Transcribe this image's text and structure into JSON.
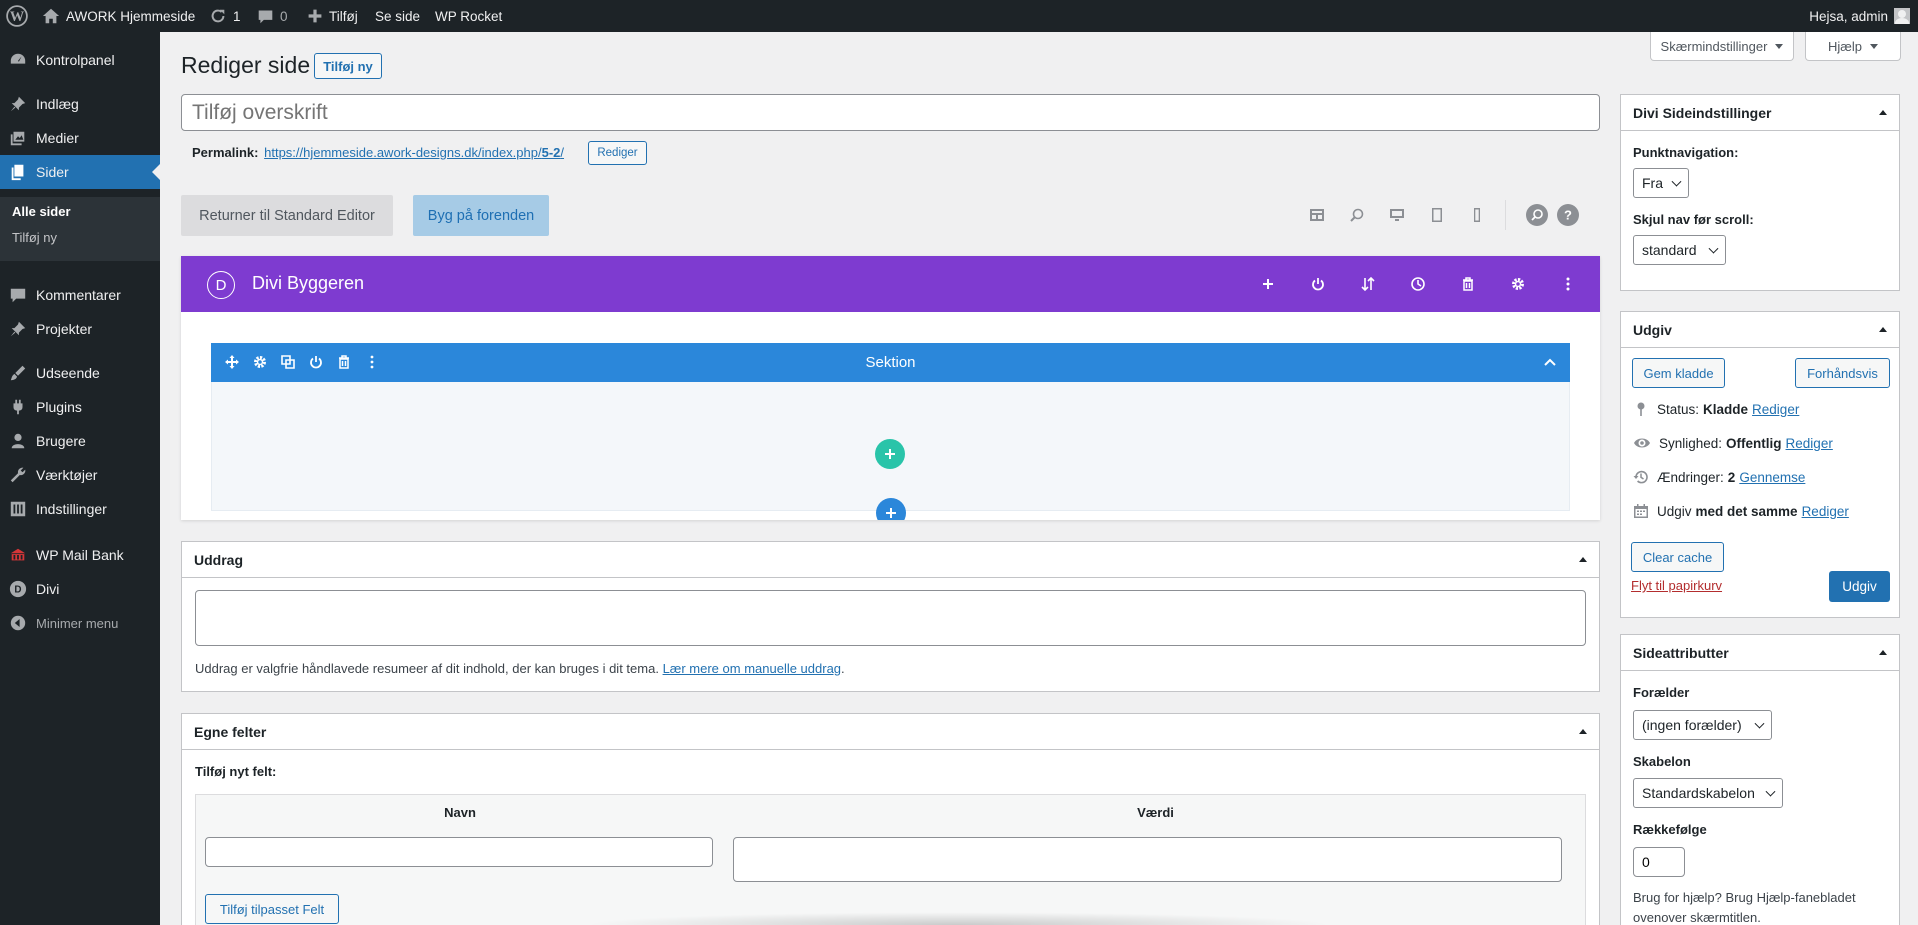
{
  "admin_bar": {
    "site_name": "AWORK Hjemmeside",
    "updates_count": "1",
    "comments_count": "0",
    "new_label": "Tilføj",
    "view_page": "Se side",
    "wp_rocket": "WP Rocket",
    "greeting": "Hejsa, admin"
  },
  "sidebar": {
    "dashboard": "Kontrolpanel",
    "posts": "Indlæg",
    "media": "Medier",
    "pages": "Sider",
    "pages_sub": [
      "Alle sider",
      "Tilføj ny"
    ],
    "comments": "Kommentarer",
    "projects": "Projekter",
    "appearance": "Udseende",
    "plugins": "Plugins",
    "users": "Brugere",
    "tools": "Værktøjer",
    "settings": "Indstillinger",
    "wp_mail_bank": "WP Mail Bank",
    "divi": "Divi",
    "collapse": "Minimer menu"
  },
  "screen_options": "Skærmindstillinger",
  "help": "Hjælp",
  "page_title": "Rediger side",
  "add_new": "Tilføj ny",
  "title_placeholder": "Tilføj overskrift",
  "permalink": {
    "label": "Permalink:",
    "url_base": "https://hjemmeside.awork-designs.dk/index.php/",
    "url_slug": "5-2",
    "url_end": "/",
    "edit": "Rediger"
  },
  "editor_buttons": {
    "return_standard": "Returner til Standard Editor",
    "build_front": "Byg på forenden"
  },
  "divi": {
    "title": "Divi Byggeren",
    "logo_letter": "D",
    "section_label": "Sektion",
    "header_color": "#7e3bd0",
    "section_color": "#2b87da",
    "add_module_color": "#29c4a9"
  },
  "excerpt": {
    "title": "Uddrag",
    "help_text": "Uddrag er valgfrie håndlavede resumeer af dit indhold, der kan bruges i dit tema.",
    "help_link": "Lær mere om manuelle uddrag",
    "period": "."
  },
  "custom_fields": {
    "title": "Egne felter",
    "add_new_label": "Tilføj nyt felt:",
    "col_name": "Navn",
    "col_value": "Værdi",
    "add_button": "Tilføj tilpasset Felt"
  },
  "divi_settings": {
    "title": "Divi Sideindstillinger",
    "dot_nav_label": "Punktnavigation:",
    "dot_nav_value": "Fra",
    "hide_nav_label": "Skjul nav før scroll:",
    "hide_nav_value": "standard"
  },
  "publish": {
    "title": "Udgiv",
    "save_draft": "Gem kladde",
    "preview": "Forhåndsvis",
    "status_label": "Status:",
    "status_value": "Kladde",
    "visibility_label": "Synlighed:",
    "visibility_value": "Offentlig",
    "revisions_label": "Ændringer:",
    "revisions_value": "2",
    "browse": "Gennemse",
    "publish_label": "Udgiv",
    "publish_value": "med det samme",
    "edit": "Rediger",
    "clear_cache": "Clear cache",
    "trash": "Flyt til papirkurv",
    "publish_button": "Udgiv"
  },
  "page_attributes": {
    "title": "Sideattributter",
    "parent_label": "Forælder",
    "parent_value": "(ingen forælder)",
    "template_label": "Skabelon",
    "template_value": "Standardskabelon",
    "order_label": "Rækkefølge",
    "order_value": "0",
    "help_text_1": "Brug for hjælp? Brug Hjælp-fanebladet",
    "help_text_2": "ovenover skærmtitlen."
  }
}
